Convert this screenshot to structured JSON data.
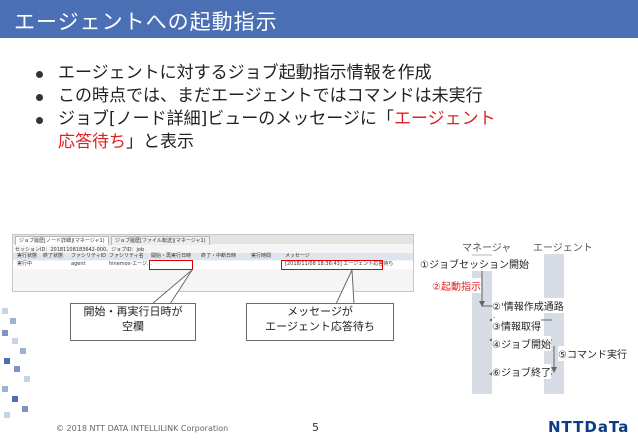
{
  "slide": {
    "title": "エージェントへの起動指示",
    "bullets": [
      {
        "text": "エージェントに対するジョブ起動指示情報を作成",
        "line2": "",
        "highlight": ""
      },
      {
        "text": "この時点では、まだエージェントではコマンドは未実行",
        "line2": "",
        "highlight": ""
      },
      {
        "text": "ジョブ[ノード詳細]ビューのメッセージに「",
        "highlight": "エージェント",
        "highlight2": "応答待ち",
        "suffix": "」と表示"
      }
    ],
    "footer": {
      "copyright": "© 2018 NTT DATA INTELLILINK  Corporation",
      "page": "5",
      "logo": "NTTDaTa"
    }
  },
  "screenshot": {
    "tab1": "ジョブ履歴[ノード詳細](マネージャ1)",
    "tab2": "ジョブ履歴[ファイル転送](マネージャ1)",
    "session": "セッションID：20181108183642-000、ジョブID：job",
    "headers": [
      "実行状態",
      "終了状態",
      "ファシリティID",
      "ファシリティ名",
      "開始・再実行日時",
      "終了・中断日時",
      "実行時間",
      "メッセージ"
    ],
    "row": {
      "status": "実行中",
      "end": "",
      "facility_id": "agent",
      "facility_name": "hinemos-エージ...",
      "start": "",
      "finish": "",
      "time": "",
      "message": "[2018/11/08 18:36:43] エージェント応答待ち"
    }
  },
  "callouts": {
    "left": {
      "line1": "開始・再実行日時が",
      "line2": "空欄"
    },
    "right": {
      "line1": "メッセージが",
      "line2": "エージェント応答待ち"
    }
  },
  "sequence": {
    "manager": "マネージャ",
    "agent": "エージェント",
    "steps": [
      "①ジョブセッション開始",
      "②起動指示",
      "②'情報作成通路",
      "③情報取得",
      "④ジョブ開始",
      "⑤コマンド実行",
      "⑥ジョブ終了"
    ]
  },
  "colors": {
    "title_bar": "#4a6fb5",
    "highlight": "#e02020",
    "logo": "#0c3b87"
  }
}
